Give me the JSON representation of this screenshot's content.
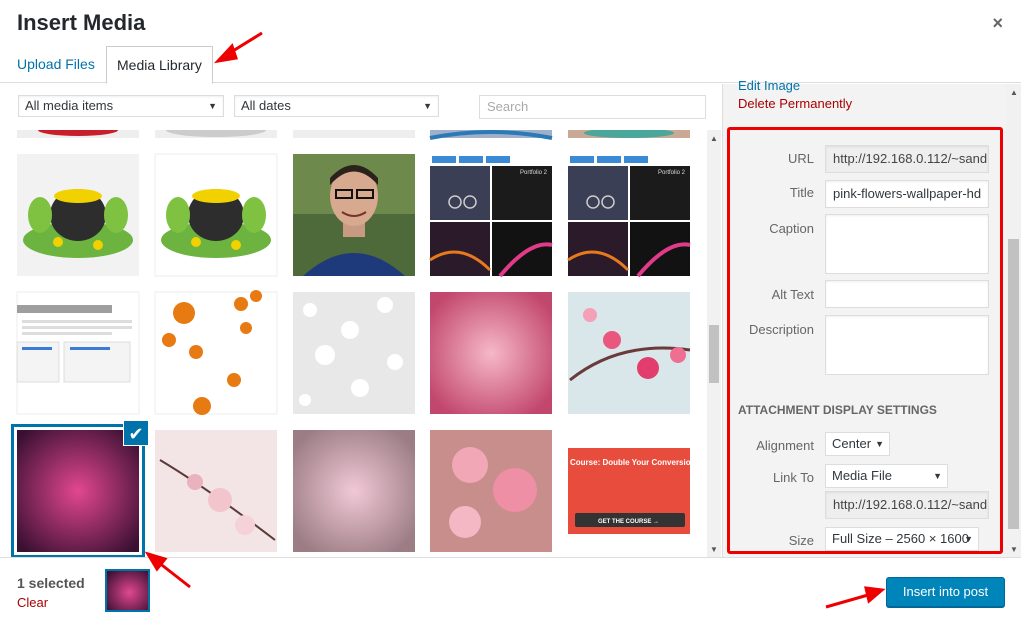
{
  "modal": {
    "title": "Insert Media",
    "close_label": "×"
  },
  "tabs": [
    {
      "label": "Upload Files"
    },
    {
      "label": "Media Library"
    }
  ],
  "filters": {
    "media_type": "All media items",
    "dates": "All dates",
    "search_placeholder": "Search"
  },
  "sidebar": {
    "edit_image": "Edit Image",
    "delete_permanently": "Delete Permanently",
    "fields": {
      "url": {
        "label": "URL",
        "value": "http://192.168.0.112/~sand"
      },
      "title": {
        "label": "Title",
        "value": "pink-flowers-wallpaper-hd"
      },
      "caption": {
        "label": "Caption",
        "value": ""
      },
      "alt_text": {
        "label": "Alt Text",
        "value": ""
      },
      "description": {
        "label": "Description",
        "value": ""
      }
    },
    "display_settings": {
      "heading": "ATTACHMENT DISPLAY SETTINGS",
      "alignment": {
        "label": "Alignment",
        "value": "Center"
      },
      "link_to": {
        "label": "Link To",
        "value": "Media File",
        "url": "http://192.168.0.112/~sand"
      },
      "size": {
        "label": "Size",
        "value": "Full Size – 2560 × 1600"
      }
    }
  },
  "thumbnails": {
    "portfolio_caption": "Portfolio 2",
    "course_headline": "Course: Double Your Conversion In",
    "course_button": "GET THE COURSE →"
  },
  "footer": {
    "selected_count": "1 selected",
    "clear": "Clear",
    "insert_button": "Insert into post"
  },
  "colors": {
    "accent": "#0073aa",
    "primary_button": "#0085ba",
    "danger": "#aa0000",
    "annotation": "#e00000"
  }
}
